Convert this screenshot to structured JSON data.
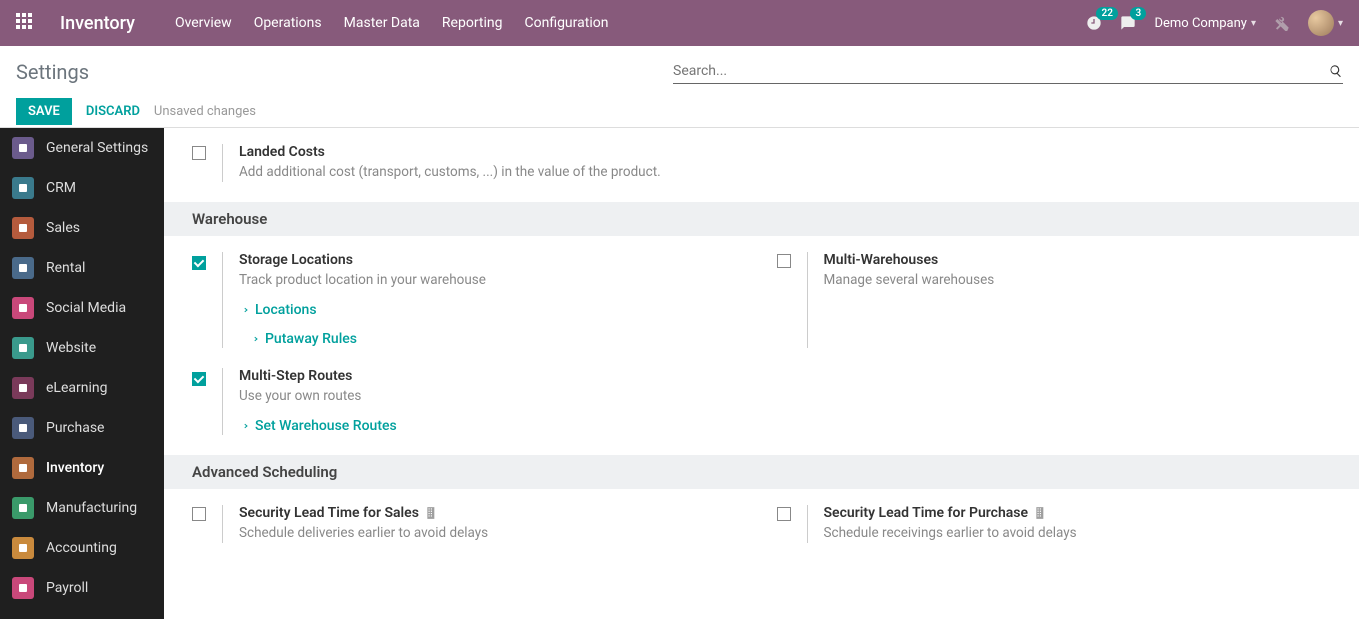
{
  "header": {
    "brand": "Inventory",
    "menu": [
      "Overview",
      "Operations",
      "Master Data",
      "Reporting",
      "Configuration"
    ],
    "clock_badge": "22",
    "chat_badge": "3",
    "company": "Demo Company"
  },
  "controlbar": {
    "title": "Settings",
    "search_placeholder": "Search...",
    "save": "SAVE",
    "discard": "DISCARD",
    "status": "Unsaved changes"
  },
  "sidebar": {
    "items": [
      {
        "label": "General Settings",
        "color": "#6b5b8c"
      },
      {
        "label": "CRM",
        "color": "#3a7a8c"
      },
      {
        "label": "Sales",
        "color": "#b55b3d"
      },
      {
        "label": "Rental",
        "color": "#4a6a8a"
      },
      {
        "label": "Social Media",
        "color": "#c9487a"
      },
      {
        "label": "Website",
        "color": "#3a9a8c"
      },
      {
        "label": "eLearning",
        "color": "#7a3a5a"
      },
      {
        "label": "Purchase",
        "color": "#4a5a7a"
      },
      {
        "label": "Inventory",
        "color": "#b06a3d"
      },
      {
        "label": "Manufacturing",
        "color": "#3a9a6a"
      },
      {
        "label": "Accounting",
        "color": "#c98a3d"
      },
      {
        "label": "Payroll",
        "color": "#c9487a"
      }
    ],
    "active": "Inventory"
  },
  "sections": {
    "landed": {
      "title": "Landed Costs",
      "desc": "Add additional cost (transport, customs, ...) in the value of the product."
    },
    "warehouse": {
      "header": "Warehouse",
      "storage": {
        "title": "Storage Locations",
        "desc": "Track product location in your warehouse",
        "link_locations": "Locations",
        "link_putaway": "Putaway Rules"
      },
      "multiwh": {
        "title": "Multi-Warehouses",
        "desc": "Manage several warehouses"
      },
      "routes": {
        "title": "Multi-Step Routes",
        "desc": "Use your own routes",
        "link_routes": "Set Warehouse Routes"
      }
    },
    "advanced": {
      "header": "Advanced Scheduling",
      "sales_lead": {
        "title": "Security Lead Time for Sales",
        "desc": "Schedule deliveries earlier to avoid delays"
      },
      "purchase_lead": {
        "title": "Security Lead Time for Purchase",
        "desc": "Schedule receivings earlier to avoid delays"
      }
    }
  }
}
